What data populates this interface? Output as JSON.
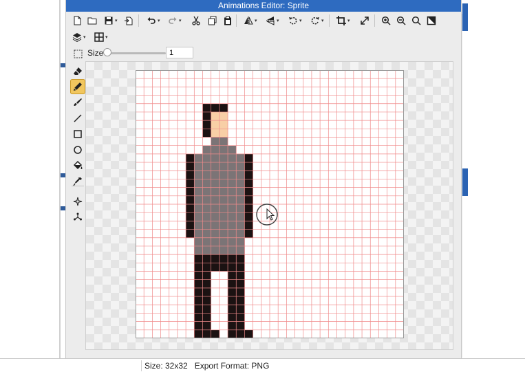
{
  "window": {
    "title": "Animations Editor: Sprite"
  },
  "toolbar": {
    "row1": [
      {
        "name": "new-file-icon",
        "icon": "new-file"
      },
      {
        "name": "open-folder-icon",
        "icon": "folder"
      },
      {
        "name": "save-icon",
        "icon": "save",
        "caret": true
      },
      {
        "name": "export-icon",
        "icon": "export"
      },
      {
        "name": "undo-icon",
        "icon": "undo",
        "caret": true
      },
      {
        "name": "redo-icon",
        "icon": "redo",
        "caret": true
      },
      {
        "name": "cut-icon",
        "icon": "cut"
      },
      {
        "name": "copy-icon",
        "icon": "copy"
      },
      {
        "name": "paste-icon",
        "icon": "paste"
      },
      {
        "name": "flip-horizontal-icon",
        "icon": "flip-h",
        "caret": true
      },
      {
        "name": "flip-vertical-icon",
        "icon": "flip-v",
        "caret": true
      },
      {
        "name": "rotate-left-icon",
        "icon": "rotate-left",
        "caret": true
      },
      {
        "name": "rotate-right-icon",
        "icon": "rotate-right",
        "caret": true
      },
      {
        "name": "crop-icon",
        "icon": "crop",
        "caret": true
      },
      {
        "name": "resize-icon",
        "icon": "resize"
      },
      {
        "name": "zoom-in-icon",
        "icon": "zoom-in"
      },
      {
        "name": "zoom-out-icon",
        "icon": "zoom-out"
      },
      {
        "name": "zoom-fit-icon",
        "icon": "zoom-fit"
      },
      {
        "name": "color-swap-icon",
        "icon": "color-swap"
      }
    ],
    "row2": [
      {
        "name": "layers-icon",
        "icon": "layers",
        "caret": true
      },
      {
        "name": "grid-icon",
        "icon": "grid",
        "caret": true
      }
    ]
  },
  "size_control": {
    "label": "Size",
    "value": "1",
    "slider_fraction": 0.0
  },
  "left_tools": [
    {
      "name": "select-rect-tool",
      "icon": "select-rect"
    },
    {
      "name": "eraser-tool",
      "icon": "eraser"
    },
    {
      "name": "pencil-tool",
      "icon": "pencil",
      "active": true
    },
    {
      "name": "brush-tool",
      "icon": "brush"
    },
    {
      "name": "line-tool",
      "icon": "line"
    },
    {
      "name": "rectangle-tool",
      "icon": "rectangle"
    },
    {
      "name": "ellipse-tool",
      "icon": "ellipse"
    },
    {
      "name": "fill-tool",
      "icon": "bucket"
    },
    {
      "name": "eyedropper-tool",
      "icon": "eyedropper"
    },
    {
      "name": "magic-select-tool",
      "icon": "sparkle"
    },
    {
      "name": "transform-tool",
      "icon": "transform"
    }
  ],
  "sprite": {
    "grid_size": 32,
    "grid_color": "#f08a8a",
    "colors": {
      "K": "#1b1212",
      "G": "#7b7476",
      "S": "#f8cfa6"
    },
    "rows": [
      "................................",
      "................................",
      "................................",
      "................................",
      "........KKK.....................",
      "........KSS.....................",
      "........KSS.....................",
      "........KSS.....................",
      ".........GG.....................",
      "........GGGG....................",
      "......KGGGGGGK..................",
      "......KGGGGGGK..................",
      "......KGGGGGGK..................",
      "......KGGGGGGK..................",
      "......KGGGGGGK..................",
      "......KGGGGGGK..................",
      "......KGGGGGGK..................",
      "......KGGGGGGK..................",
      "......KGGGGGGK..................",
      "......KGGGGGGK..................",
      ".......GGGGGG...................",
      ".......GGGGGG...................",
      ".......KKKKKK...................",
      ".......KKKKKK...................",
      ".......KK..KK...................",
      ".......KK..KK...................",
      ".......KK..KK...................",
      ".......KK..KK...................",
      ".......KK..KK...................",
      ".......KK..KK...................",
      ".......KK..KK...................",
      ".......KKK.KKK.................."
    ]
  },
  "status": {
    "text": "Size: 32x32   Export Format: PNG"
  }
}
